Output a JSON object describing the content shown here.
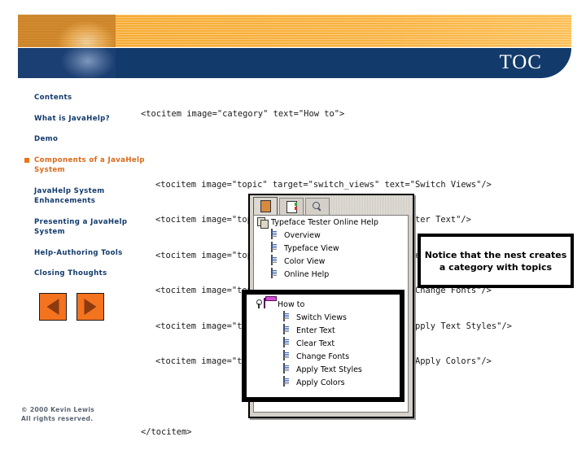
{
  "header": {
    "title": "TOC",
    "photo_icon": "hands-on-device-photo",
    "orange_band_color": "#f9b342",
    "navy_band_color": "#123a6b"
  },
  "sidebar": {
    "items": [
      {
        "label": "Contents",
        "active": false
      },
      {
        "label": "What is JavaHelp?",
        "active": false
      },
      {
        "label": "Demo",
        "active": false
      },
      {
        "label": "Components of a JavaHelp System",
        "active": true
      },
      {
        "label": "JavaHelp System Enhancements",
        "active": false
      },
      {
        "label": "Presenting a JavaHelp System",
        "active": false
      },
      {
        "label": "Help-Authoring Tools",
        "active": false
      },
      {
        "label": "Closing Thoughts",
        "active": false
      }
    ],
    "active_color": "#d9691a",
    "inactive_color": "#123a6b"
  },
  "nav_buttons": {
    "prev_label": "Previous slide",
    "next_label": "Next slide",
    "color": "#f4731f"
  },
  "footer": {
    "line1": "© 2000 Kevin Lewis",
    "line2": "All rights reserved."
  },
  "code": {
    "lines": [
      "<tocitem image=\"category\" text=\"How to\">",
      "",
      "  <tocitem image=\"topic\" target=\"switch_views\" text=\"Switch Views\"/>",
      "  <tocitem image=\"topic\" target=\"enter_text\" text=\"Enter Text\"/>",
      "  <tocitem image=\"topic\" target=\"clear_text\" text=\"Clear Text\"/>",
      "  <tocitem image=\"topic\" target=\"change_fonts\" text=\"Change Fonts\"/>",
      "  <tocitem image=\"topic\" target=\"text_styles\" text=\"Apply Text Styles\"/>",
      "  <tocitem image=\"topic\" target=\"apply_colors\" text=\"Apply Colors\"/>",
      "",
      "</tocitem>"
    ],
    "line_0": "<tocitem image=\"category\" text=\"How to\">",
    "line_1": "<tocitem image=\"topic\" target=\"switch_views\" text=\"Switch Views\"/>",
    "line_2": "<tocitem image=\"topic\" target=\"enter_text\" text=\"Enter Text\"/>",
    "line_3": "<tocitem image=\"topic\" target=\"clear_text\" text=\"Clear Text\"/>",
    "line_4": "<tocitem image=\"topic\" target=\"change_fonts\" text=\"Change Fonts\"/>",
    "line_5": "<tocitem image=\"topic\" target=\"text_styles\" text=\"Apply Text Styles\"/>",
    "line_6": "<tocitem image=\"topic\" target=\"apply_colors\" text=\"Apply Colors\"/>",
    "line_7": "</tocitem>"
  },
  "help_window": {
    "tabs": [
      {
        "name": "toc-tab",
        "icon": "book-icon",
        "selected": true
      },
      {
        "name": "index-tab",
        "icon": "index-icon",
        "selected": false
      },
      {
        "name": "search-tab",
        "icon": "magnifier-icon",
        "selected": false
      }
    ],
    "tree": {
      "root": {
        "label": "Typeface Tester Online Help",
        "icon": "pages-icon"
      },
      "children": [
        {
          "label": "Overview",
          "icon": "document-icon"
        },
        {
          "label": "Typeface View",
          "icon": "document-icon"
        },
        {
          "label": "Color View",
          "icon": "document-icon"
        },
        {
          "label": "Online Help",
          "icon": "document-icon"
        }
      ],
      "category": {
        "label": "How to",
        "icon": "book-icon",
        "expanded": true
      },
      "category_children": [
        {
          "label": "Switch Views",
          "icon": "document-icon"
        },
        {
          "label": "Enter Text",
          "icon": "document-icon"
        },
        {
          "label": "Clear Text",
          "icon": "document-icon"
        },
        {
          "label": "Change Fonts",
          "icon": "document-icon"
        },
        {
          "label": "Apply Text Styles",
          "icon": "document-icon"
        },
        {
          "label": "Apply Colors",
          "icon": "document-icon"
        }
      ]
    }
  },
  "callout": {
    "text": "Notice that the nest creates a category with topics"
  }
}
